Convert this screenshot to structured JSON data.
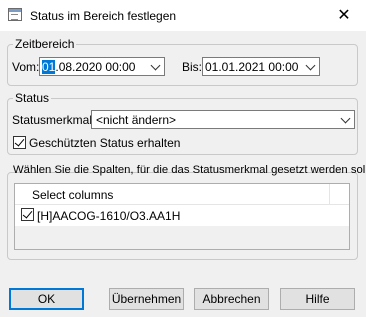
{
  "window": {
    "title": "Status im Bereich festlegen",
    "close_glyph": "✕"
  },
  "zeitbereich": {
    "legend": "Zeitbereich",
    "from_label": "Vom:",
    "from_value_selected": "01",
    "from_value_rest": ".08.2020  00:00",
    "to_label": "Bis:",
    "to_value": "01.01.2021  00:00"
  },
  "status": {
    "legend": "Status",
    "statusmerkmal_label": "Statusmerkmal:",
    "statusmerkmal_value": "<nicht ändern>",
    "keep_protected_label": "Geschützten Status erhalten",
    "keep_protected_checked": true
  },
  "columns": {
    "legend": "Wählen Sie die Spalten, für die das Statusmerkmal gesetzt werden soll.",
    "header": "Select columns",
    "items": [
      {
        "label": "[H]AACOG-1610/O3.AA1H",
        "checked": true
      }
    ]
  },
  "buttons": {
    "ok": "OK",
    "apply": "Übernehmen",
    "cancel": "Abbrechen",
    "help": "Hilfe"
  }
}
